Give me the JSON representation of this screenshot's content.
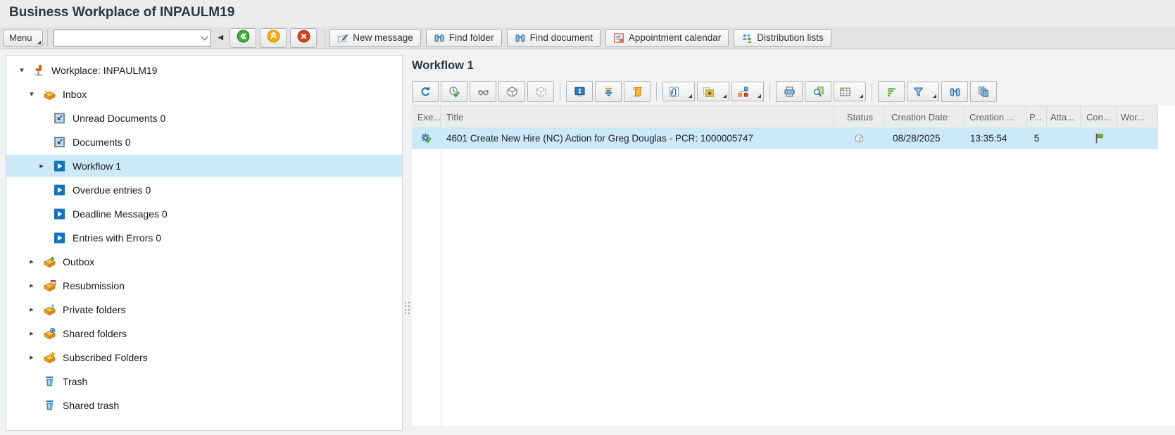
{
  "window": {
    "title": "Business Workplace of INPAULM19"
  },
  "toolbar": {
    "menu_label": "Menu",
    "command_value": "",
    "command_placeholder": "",
    "back_icon": "back-icon",
    "exit_icon": "exit-icon",
    "cancel_icon": "cancel-icon",
    "buttons": [
      {
        "label": "New message",
        "icon": "new-message-icon"
      },
      {
        "label": "Find folder",
        "icon": "find-folder-icon"
      },
      {
        "label": "Find document",
        "icon": "find-document-icon"
      },
      {
        "label": "Appointment calendar",
        "icon": "appointment-calendar-icon"
      },
      {
        "label": "Distribution lists",
        "icon": "distribution-lists-icon"
      }
    ]
  },
  "tree": {
    "items": [
      {
        "level": 0,
        "state": "expanded",
        "icon": "workplace-icon",
        "label": "Workplace: INPAULM19"
      },
      {
        "level": 1,
        "state": "expanded",
        "icon": "inbox-icon",
        "label": "Inbox"
      },
      {
        "level": 2,
        "state": "leaf",
        "icon": "unread-documents-icon",
        "label": "Unread Documents 0"
      },
      {
        "level": 2,
        "state": "leaf",
        "icon": "documents-icon",
        "label": "Documents 0"
      },
      {
        "level": 2,
        "state": "collapsed",
        "icon": "workflow-icon",
        "label": "Workflow 1",
        "selected": true
      },
      {
        "level": 2,
        "state": "leaf",
        "icon": "workflow-icon",
        "label": "Overdue entries 0"
      },
      {
        "level": 2,
        "state": "leaf",
        "icon": "workflow-icon",
        "label": "Deadline Messages 0"
      },
      {
        "level": 2,
        "state": "leaf",
        "icon": "workflow-icon",
        "label": "Entries with Errors 0"
      },
      {
        "level": 1,
        "state": "collapsed",
        "icon": "outbox-icon",
        "label": "Outbox"
      },
      {
        "level": 1,
        "state": "collapsed",
        "icon": "resubmission-icon",
        "label": "Resubmission"
      },
      {
        "level": 1,
        "state": "collapsed",
        "icon": "private-folders-icon",
        "label": "Private folders"
      },
      {
        "level": 1,
        "state": "collapsed",
        "icon": "shared-folders-icon",
        "label": "Shared folders"
      },
      {
        "level": 1,
        "state": "collapsed",
        "icon": "subscribed-folders-icon",
        "label": "Subscribed Folders"
      },
      {
        "level": 1,
        "state": "leaf",
        "icon": "trash-icon",
        "label": "Trash"
      },
      {
        "level": 1,
        "state": "leaf",
        "icon": "shared-trash-icon",
        "label": "Shared trash"
      }
    ]
  },
  "workarea": {
    "title": "Workflow 1",
    "toolbar": [
      {
        "name": "refresh-icon"
      },
      {
        "name": "execute-work-item-icon"
      },
      {
        "name": "display-work-item-icon"
      },
      {
        "name": "object-icon"
      },
      {
        "name": "object-dotted-icon",
        "gap_after": true
      },
      {
        "name": "work-item-display-icon"
      },
      {
        "name": "sort-priority-icon"
      },
      {
        "name": "workflow-log-icon",
        "gap_after": true
      },
      {
        "name": "attachment-icon",
        "dropdown": true
      },
      {
        "name": "create-attachment-icon",
        "dropdown": true
      },
      {
        "name": "org-assignment-icon",
        "dropdown": true,
        "gap_after": true
      },
      {
        "name": "print-icon"
      },
      {
        "name": "print-preview-icon"
      },
      {
        "name": "table-view-icon",
        "dropdown": true,
        "gap_after": true
      },
      {
        "name": "sort-icon"
      },
      {
        "name": "filter-icon",
        "dropdown": true
      },
      {
        "name": "find-icon"
      },
      {
        "name": "views-icon"
      }
    ],
    "table": {
      "columns": [
        {
          "key": "exe",
          "label": "Exe..."
        },
        {
          "key": "title",
          "label": "Title"
        },
        {
          "key": "status",
          "label": "Status"
        },
        {
          "key": "cdate",
          "label": "Creation Date"
        },
        {
          "key": "ctime",
          "label": "Creation ..."
        },
        {
          "key": "prio",
          "label": "P..."
        },
        {
          "key": "atta",
          "label": "Atta..."
        },
        {
          "key": "conf",
          "label": "Con..."
        },
        {
          "key": "wor",
          "label": "Wor..."
        }
      ],
      "rows": [
        {
          "exe_icon": "execute-check-icon",
          "title": "4601 Create New Hire (NC) Action for Greg Douglas - PCR: 1000005747",
          "status_icon": "package-status-icon",
          "creation_date": "08/28/2025",
          "creation_time": "13:35:54",
          "priority": "5",
          "attachments": "",
          "confirm_icon": "green-flag-icon",
          "workitem": ""
        }
      ]
    }
  },
  "colors": {
    "selection_blue": "#cde9f8",
    "flag_green": "#6cb52d",
    "icon_blue": "#1373bb",
    "icon_orange": "#f0a32f",
    "toolbar_grey": "#e2e3e4"
  }
}
